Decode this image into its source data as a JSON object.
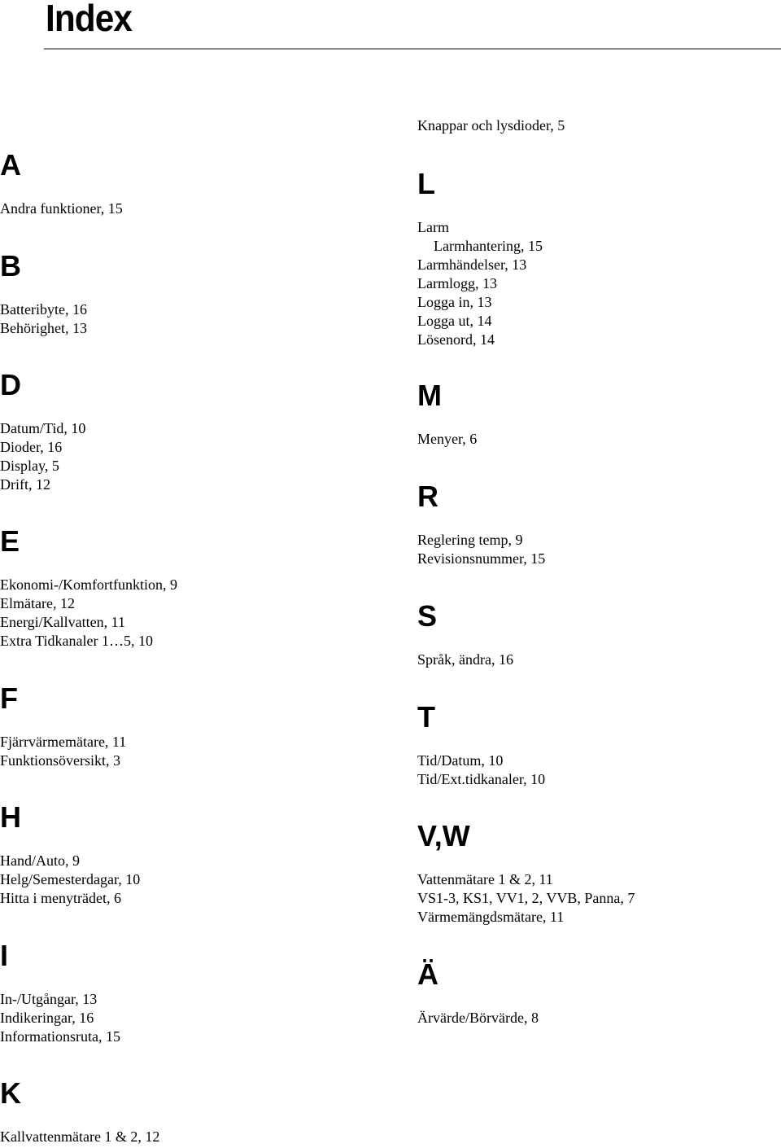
{
  "page": {
    "title": "Index"
  },
  "left_column": [
    {
      "letter": "A",
      "entries": [
        {
          "text": "Andra funktioner, 15"
        }
      ]
    },
    {
      "letter": "B",
      "entries": [
        {
          "text": "Batteribyte, 16"
        },
        {
          "text": "Behörighet, 13"
        }
      ]
    },
    {
      "letter": "D",
      "entries": [
        {
          "text": "Datum/Tid, 10"
        },
        {
          "text": "Dioder, 16"
        },
        {
          "text": "Display, 5"
        },
        {
          "text": "Drift, 12"
        }
      ]
    },
    {
      "letter": "E",
      "entries": [
        {
          "text": "Ekonomi-/Komfortfunktion, 9"
        },
        {
          "text": "Elmätare, 12"
        },
        {
          "text": "Energi/Kallvatten, 11"
        },
        {
          "text": "Extra Tidkanaler 1…5, 10"
        }
      ]
    },
    {
      "letter": "F",
      "entries": [
        {
          "text": "Fjärrvärmemätare, 11"
        },
        {
          "text": "Funktionsöversikt, 3"
        }
      ]
    },
    {
      "letter": "H",
      "entries": [
        {
          "text": "Hand/Auto, 9"
        },
        {
          "text": "Helg/Semesterdagar, 10"
        },
        {
          "text": "Hitta i menyträdet, 6"
        }
      ]
    },
    {
      "letter": "I",
      "entries": [
        {
          "text": "In-/Utgångar, 13"
        },
        {
          "text": "Indikeringar, 16"
        },
        {
          "text": "Informationsruta, 15"
        }
      ]
    },
    {
      "letter": "K",
      "entries": [
        {
          "text": "Kallvattenmätare 1 & 2, 12"
        }
      ]
    }
  ],
  "right_column": {
    "continued_entry": "Knappar och lysdioder, 5",
    "sections": [
      {
        "letter": "L",
        "entries": [
          {
            "text": "Larm"
          },
          {
            "text": "Larmhantering, 15",
            "sub": true
          },
          {
            "text": "Larmhändelser, 13"
          },
          {
            "text": "Larmlogg, 13"
          },
          {
            "text": "Logga in, 13"
          },
          {
            "text": "Logga ut, 14"
          },
          {
            "text": "Lösenord, 14"
          }
        ]
      },
      {
        "letter": "M",
        "entries": [
          {
            "text": "Menyer, 6"
          }
        ]
      },
      {
        "letter": "R",
        "entries": [
          {
            "text": "Reglering temp, 9"
          },
          {
            "text": "Revisionsnummer, 15"
          }
        ]
      },
      {
        "letter": "S",
        "entries": [
          {
            "text": "Språk, ändra, 16"
          }
        ]
      },
      {
        "letter": "T",
        "entries": [
          {
            "text": "Tid/Datum, 10"
          },
          {
            "text": "Tid/Ext.tidkanaler, 10"
          }
        ]
      },
      {
        "letter": "V,W",
        "entries": [
          {
            "text": "Vattenmätare 1 & 2, 11"
          },
          {
            "text": "VS1-3, KS1, VV1, 2, VVB, Panna, 7"
          },
          {
            "text": "Värmemängdsmätare, 11"
          }
        ]
      },
      {
        "letter": "Ä",
        "entries": [
          {
            "text": "Ärvärde/Börvärde, 8"
          }
        ]
      }
    ]
  }
}
